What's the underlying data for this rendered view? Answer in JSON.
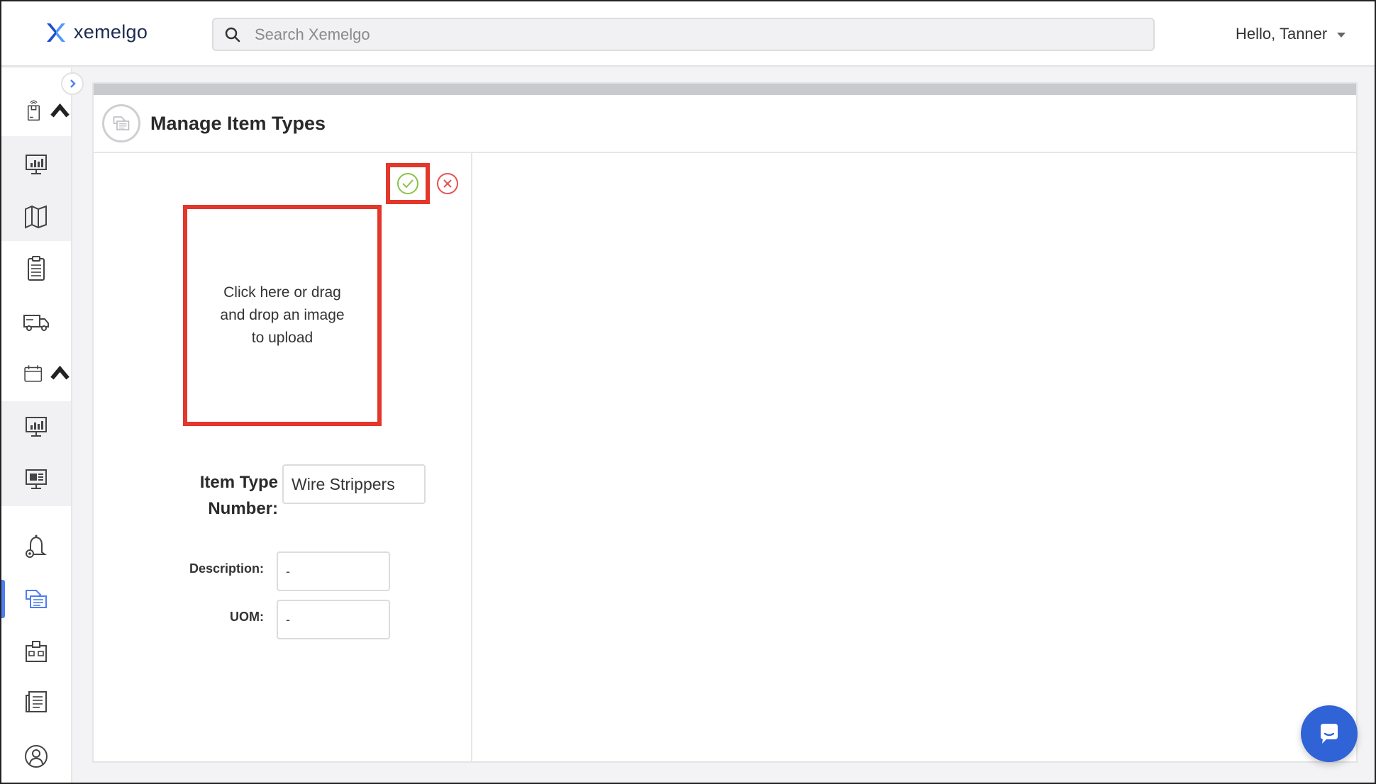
{
  "app": {
    "name": "xemelgo",
    "brand_color": "#2f63d6"
  },
  "search": {
    "placeholder": "Search Xemelgo"
  },
  "user": {
    "greeting": "Hello, Tanner"
  },
  "sidebar": {
    "items": [
      {
        "icon": "tracked-asset-icon",
        "expanded": true
      },
      {
        "icon": "dashboard-icon"
      },
      {
        "icon": "map-icon"
      },
      {
        "icon": "clipboard-checklist-icon"
      },
      {
        "icon": "delivery-truck-icon"
      },
      {
        "icon": "calendar-icon",
        "expanded": true
      },
      {
        "icon": "dashboard-icon"
      },
      {
        "icon": "monitor-report-icon"
      },
      {
        "icon": "alert-bell-icon"
      },
      {
        "icon": "item-types-icon",
        "active": true
      },
      {
        "icon": "organization-icon"
      },
      {
        "icon": "document-list-icon"
      },
      {
        "icon": "user-profile-icon"
      }
    ]
  },
  "page": {
    "title": "Manage Item Types"
  },
  "form": {
    "upload_text": "Click here or drag and drop an image to upload",
    "item_type_label": "Item Type Number:",
    "item_type_value": "Wire Strippers",
    "description_label": "Description:",
    "description_value": "-",
    "uom_label": "UOM:",
    "uom_value": "-"
  },
  "colors": {
    "accent": "#4f7df2",
    "confirm": "#8bc34a",
    "cancel": "#e55353",
    "highlight": "#e3372b"
  }
}
